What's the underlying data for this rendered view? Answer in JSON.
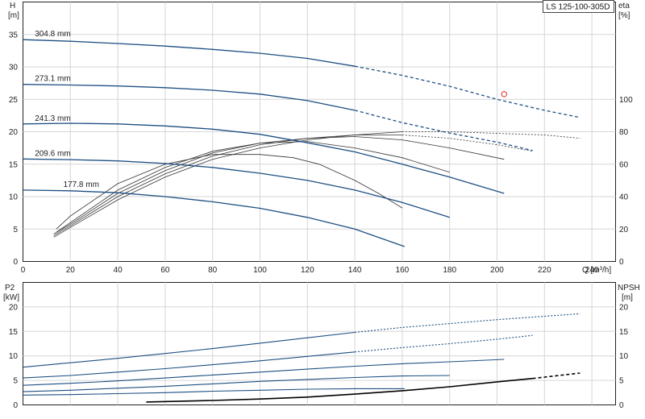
{
  "chart_data": [
    {
      "type": "line",
      "title": "LS 125-100-305D",
      "xlabel": "Q [m³/h]",
      "ylabel": "H",
      "yunit": "[m]",
      "y2label": "eta",
      "y2unit": "[%]",
      "xlim": [
        0,
        250
      ],
      "ylim": [
        0,
        40
      ],
      "y2lim": [
        0,
        160
      ],
      "xticks": [
        "0",
        "20",
        "40",
        "60",
        "80",
        "100",
        "120",
        "140",
        "160",
        "180",
        "200",
        "220",
        "240"
      ],
      "yticks": [
        "0",
        "5",
        "10",
        "15",
        "20",
        "25",
        "30",
        "35"
      ],
      "y2ticks": [
        "0",
        "20",
        "40",
        "60",
        "80",
        "100"
      ],
      "head_series": [
        {
          "name": "304.8 mm",
          "solid": [
            [
              0,
              34.2
            ],
            [
              20,
              33.95
            ],
            [
              40,
              33.6
            ],
            [
              60,
              33.2
            ],
            [
              80,
              32.7
            ],
            [
              100,
              32.1
            ],
            [
              120,
              31.3
            ],
            [
              140,
              30.1
            ]
          ],
          "dashed": [
            [
              140,
              30.1
            ],
            [
              160,
              28.7
            ],
            [
              180,
              27.0
            ],
            [
              200,
              25.0
            ],
            [
              220,
              23.3
            ],
            [
              235,
              22.2
            ]
          ]
        },
        {
          "name": "273.1 mm",
          "solid": [
            [
              0,
              27.3
            ],
            [
              20,
              27.2
            ],
            [
              40,
              27.05
            ],
            [
              60,
              26.8
            ],
            [
              80,
              26.4
            ],
            [
              100,
              25.8
            ],
            [
              120,
              24.8
            ],
            [
              140,
              23.3
            ]
          ],
          "dashed": [
            [
              140,
              23.3
            ],
            [
              160,
              21.4
            ],
            [
              180,
              19.8
            ],
            [
              200,
              18.4
            ],
            [
              215,
              17.1
            ]
          ]
        },
        {
          "name": "241.3 mm",
          "solid": [
            [
              0,
              21.2
            ],
            [
              20,
              21.3
            ],
            [
              40,
              21.2
            ],
            [
              60,
              20.9
            ],
            [
              80,
              20.4
            ],
            [
              100,
              19.6
            ],
            [
              120,
              18.3
            ],
            [
              140,
              16.9
            ],
            [
              160,
              15.0
            ],
            [
              180,
              13.0
            ],
            [
              203,
              10.5
            ]
          ],
          "dashed": []
        },
        {
          "name": "209.6 mm",
          "solid": [
            [
              0,
              15.8
            ],
            [
              20,
              15.7
            ],
            [
              40,
              15.5
            ],
            [
              60,
              15.1
            ],
            [
              80,
              14.5
            ],
            [
              100,
              13.6
            ],
            [
              120,
              12.5
            ],
            [
              140,
              11.0
            ],
            [
              160,
              9.1
            ],
            [
              180,
              6.8
            ]
          ],
          "dashed": []
        },
        {
          "name": "177.8 mm",
          "solid": [
            [
              0,
              11.0
            ],
            [
              20,
              10.9
            ],
            [
              40,
              10.6
            ],
            [
              60,
              10.0
            ],
            [
              80,
              9.2
            ],
            [
              100,
              8.2
            ],
            [
              120,
              6.8
            ],
            [
              140,
              5.0
            ],
            [
              161,
              2.3
            ]
          ],
          "dashed": []
        }
      ],
      "eta_series": [
        {
          "solid": [
            [
              14,
              20
            ],
            [
              20,
              28
            ],
            [
              40,
              48
            ],
            [
              60,
              60
            ],
            [
              80,
              66
            ],
            [
              100,
              66
            ],
            [
              114,
              64
            ],
            [
              125,
              60
            ],
            [
              140,
              50
            ],
            [
              150,
              42
            ],
            [
              160,
              33
            ]
          ],
          "dashed": []
        },
        {
          "solid": [
            [
              14,
              18
            ],
            [
              20,
              24
            ],
            [
              40,
              44
            ],
            [
              60,
              58
            ],
            [
              80,
              68
            ],
            [
              100,
              73
            ],
            [
              120,
              74
            ],
            [
              140,
              70
            ],
            [
              160,
              64
            ],
            [
              180,
              55
            ]
          ],
          "dashed": []
        },
        {
          "solid": [
            [
              13,
              17
            ],
            [
              20,
              23
            ],
            [
              40,
              42
            ],
            [
              60,
              56
            ],
            [
              80,
              67
            ],
            [
              100,
              73
            ],
            [
              120,
              76
            ],
            [
              140,
              77
            ],
            [
              160,
              75
            ],
            [
              180,
              70
            ],
            [
              203,
              63
            ]
          ],
          "dashed": []
        },
        {
          "solid": [
            [
              13,
              16
            ],
            [
              20,
              22
            ],
            [
              40,
              40
            ],
            [
              60,
              54
            ],
            [
              80,
              65
            ],
            [
              100,
              72
            ],
            [
              120,
              76
            ],
            [
              140,
              78
            ],
            [
              160,
              78
            ]
          ],
          "dashed": [
            [
              160,
              78
            ],
            [
              180,
              76
            ],
            [
              200,
              72
            ],
            [
              215,
              68
            ]
          ]
        },
        {
          "solid": [
            [
              13,
              15
            ],
            [
              20,
              21
            ],
            [
              40,
              38
            ],
            [
              60,
              52
            ],
            [
              80,
              63
            ],
            [
              100,
              70
            ],
            [
              120,
              75
            ],
            [
              140,
              78
            ],
            [
              160,
              80
            ]
          ],
          "dashed": [
            [
              160,
              80
            ],
            [
              180,
              80
            ],
            [
              200,
              79
            ],
            [
              220,
              78
            ],
            [
              235,
              76
            ]
          ]
        }
      ],
      "marker": {
        "x": 203,
        "y": 25.8,
        "color": "#e02020"
      }
    },
    {
      "type": "line",
      "ylabel": "P2",
      "yunit": "[kW]",
      "y2label": "NPSH",
      "y2unit": "[m]",
      "xlim": [
        0,
        250
      ],
      "ylim": [
        0,
        25
      ],
      "y2lim": [
        0,
        25
      ],
      "yticks": [
        "0",
        "5",
        "10",
        "15",
        "20"
      ],
      "y2ticks": [
        "0",
        "5",
        "10",
        "15",
        "20"
      ],
      "power_series": [
        {
          "solid": [
            [
              0,
              7.7
            ],
            [
              20,
              8.6
            ],
            [
              40,
              9.5
            ],
            [
              60,
              10.5
            ],
            [
              80,
              11.5
            ],
            [
              100,
              12.6
            ],
            [
              120,
              13.7
            ],
            [
              140,
              14.8
            ]
          ],
          "dashed": [
            [
              140,
              14.8
            ],
            [
              160,
              15.8
            ],
            [
              180,
              16.6
            ],
            [
              200,
              17.4
            ],
            [
              220,
              18.1
            ],
            [
              235,
              18.6
            ]
          ]
        },
        {
          "solid": [
            [
              0,
              5.5
            ],
            [
              20,
              6.0
            ],
            [
              40,
              6.7
            ],
            [
              60,
              7.4
            ],
            [
              80,
              8.2
            ],
            [
              100,
              9.0
            ],
            [
              120,
              9.9
            ],
            [
              140,
              10.8
            ]
          ],
          "dashed": [
            [
              140,
              10.8
            ],
            [
              160,
              11.7
            ],
            [
              180,
              12.5
            ],
            [
              200,
              13.4
            ],
            [
              215,
              14.2
            ]
          ]
        },
        {
          "solid": [
            [
              0,
              4.0
            ],
            [
              20,
              4.4
            ],
            [
              40,
              4.9
            ],
            [
              60,
              5.5
            ],
            [
              80,
              6.1
            ],
            [
              100,
              6.7
            ],
            [
              120,
              7.3
            ],
            [
              140,
              7.9
            ],
            [
              160,
              8.4
            ],
            [
              180,
              8.8
            ],
            [
              203,
              9.3
            ]
          ],
          "dashed": []
        },
        {
          "solid": [
            [
              0,
              2.7
            ],
            [
              20,
              3.0
            ],
            [
              40,
              3.4
            ],
            [
              60,
              3.8
            ],
            [
              80,
              4.3
            ],
            [
              100,
              4.8
            ],
            [
              120,
              5.2
            ],
            [
              140,
              5.6
            ],
            [
              160,
              5.9
            ],
            [
              180,
              6.0
            ]
          ],
          "dashed": []
        },
        {
          "solid": [
            [
              0,
              2.0
            ],
            [
              20,
              2.1
            ],
            [
              40,
              2.3
            ],
            [
              60,
              2.5
            ],
            [
              80,
              2.8
            ],
            [
              100,
              3.0
            ],
            [
              120,
              3.2
            ],
            [
              140,
              3.3
            ],
            [
              161,
              3.3
            ]
          ],
          "dashed": []
        }
      ],
      "npsh_series": [
        {
          "solid": [
            [
              52,
              0.6
            ],
            [
              80,
              0.9
            ],
            [
              100,
              1.2
            ],
            [
              120,
              1.6
            ],
            [
              140,
              2.2
            ],
            [
              160,
              2.9
            ],
            [
              180,
              3.7
            ],
            [
              200,
              4.7
            ],
            [
              215,
              5.4
            ]
          ],
          "dashed": [
            [
              215,
              5.4
            ],
            [
              235,
              6.5
            ]
          ]
        }
      ]
    }
  ]
}
